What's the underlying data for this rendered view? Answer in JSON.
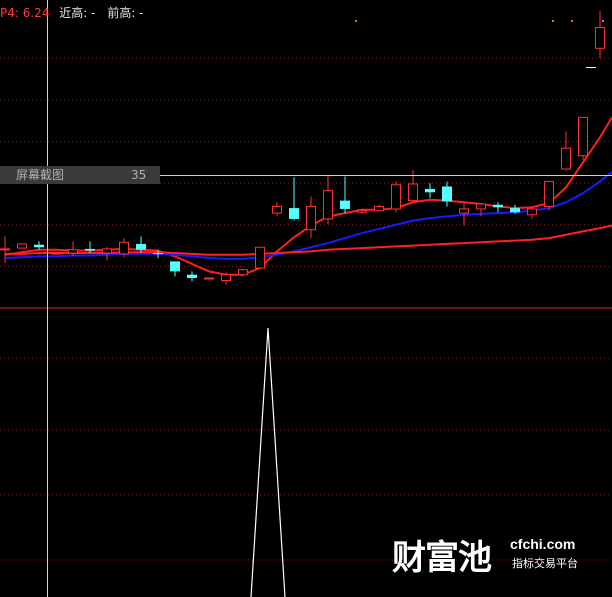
{
  "legend": {
    "p4_label": "P4: 6.24",
    "recent_high_label": "近高: -",
    "prev_high_label": "前高: -"
  },
  "crosshair": {
    "indicator_name": "屏幕截图",
    "value": "35"
  },
  "watermark": {
    "brand": "财富池",
    "site": "cfchi.com",
    "tagline": "指标交易平台"
  },
  "colors": {
    "up_candle": "#ff3232",
    "down_candle": "#54ffff",
    "ma_short": "#ff2020",
    "ma_mid": "#1a1aff",
    "ma_long": "#ff2020",
    "grid": "#7a1f1f",
    "crosshair": "#d0d0d0",
    "separator": "#8b1a1a",
    "indicator_line": "#ffffff"
  },
  "chart_data": [
    {
      "type": "candlestick",
      "candles": [
        {
          "o": 0.7,
          "c": 0.71,
          "h": 0.86,
          "l": 0.54
        },
        {
          "o": 0.72,
          "c": 0.77,
          "h": 0.77,
          "l": 0.72
        },
        {
          "o": 0.76,
          "c": 0.73,
          "h": 0.8,
          "l": 0.7
        },
        {
          "o": 0.66,
          "c": 0.66,
          "h": 0.66,
          "l": 0.66
        },
        {
          "o": 0.66,
          "c": 0.7,
          "h": 0.8,
          "l": 0.62
        },
        {
          "o": 0.71,
          "c": 0.69,
          "h": 0.8,
          "l": 0.66
        },
        {
          "o": 0.66,
          "c": 0.71,
          "h": 0.73,
          "l": 0.57
        },
        {
          "o": 0.65,
          "c": 0.79,
          "h": 0.84,
          "l": 0.61
        },
        {
          "o": 0.77,
          "c": 0.7,
          "h": 0.86,
          "l": 0.66
        },
        {
          "o": 0.66,
          "c": 0.65,
          "h": 0.7,
          "l": 0.6
        },
        {
          "o": 0.56,
          "c": 0.44,
          "h": 0.56,
          "l": 0.38
        },
        {
          "o": 0.4,
          "c": 0.36,
          "h": 0.44,
          "l": 0.32
        },
        {
          "o": 0.36,
          "c": 0.36,
          "h": 0.36,
          "l": 0.36
        },
        {
          "o": 0.33,
          "c": 0.4,
          "h": 0.43,
          "l": 0.28
        },
        {
          "o": 0.4,
          "c": 0.46,
          "h": 0.47,
          "l": 0.38
        },
        {
          "o": 0.48,
          "c": 0.73,
          "h": 0.73,
          "l": 0.48
        },
        {
          "o": 1.14,
          "c": 1.22,
          "h": 1.27,
          "l": 1.1
        },
        {
          "o": 1.2,
          "c": 1.07,
          "h": 1.57,
          "l": 1.05
        },
        {
          "o": 0.94,
          "c": 1.22,
          "h": 1.34,
          "l": 0.84
        },
        {
          "o": 1.07,
          "c": 1.41,
          "h": 1.6,
          "l": 1.01
        },
        {
          "o": 1.29,
          "c": 1.19,
          "h": 1.58,
          "l": 1.14
        },
        {
          "o": 1.15,
          "c": 1.17,
          "h": 1.17,
          "l": 1.13
        },
        {
          "o": 1.17,
          "c": 1.22,
          "h": 1.24,
          "l": 1.17
        },
        {
          "o": 1.19,
          "c": 1.48,
          "h": 1.52,
          "l": 1.15
        },
        {
          "o": 1.29,
          "c": 1.49,
          "h": 1.66,
          "l": 1.27
        },
        {
          "o": 1.43,
          "c": 1.39,
          "h": 1.5,
          "l": 1.32
        },
        {
          "o": 1.46,
          "c": 1.28,
          "h": 1.52,
          "l": 1.22
        },
        {
          "o": 1.14,
          "c": 1.19,
          "h": 1.27,
          "l": 0.99
        },
        {
          "o": 1.19,
          "c": 1.25,
          "h": 1.25,
          "l": 1.1
        },
        {
          "o": 1.24,
          "c": 1.21,
          "h": 1.27,
          "l": 1.15
        },
        {
          "o": 1.2,
          "c": 1.15,
          "h": 1.24,
          "l": 1.13
        },
        {
          "o": 1.12,
          "c": 1.19,
          "h": 1.22,
          "l": 1.07
        },
        {
          "o": 1.22,
          "c": 1.52,
          "h": 1.52,
          "l": 1.17
        },
        {
          "o": 1.67,
          "c": 1.92,
          "h": 2.12,
          "l": 1.65
        },
        {
          "o": 1.83,
          "c": 2.29,
          "h": 2.29,
          "l": 1.78
        },
        {
          "o": 3.12,
          "c": 3.37,
          "h": 3.57,
          "l": 3.0
        }
      ],
      "ma_short": [
        0.64,
        0.67,
        0.7,
        0.7,
        0.69,
        0.69,
        0.7,
        0.71,
        0.7,
        0.69,
        0.62,
        0.53,
        0.44,
        0.4,
        0.4,
        0.48,
        0.68,
        0.85,
        0.99,
        1.1,
        1.14,
        1.18,
        1.18,
        1.2,
        1.27,
        1.3,
        1.29,
        1.27,
        1.25,
        1.22,
        1.2,
        1.21,
        1.26,
        1.45,
        1.75,
        2.05
      ],
      "ma_mid": [
        0.6,
        0.61,
        0.62,
        0.62,
        0.63,
        0.63,
        0.64,
        0.65,
        0.65,
        0.65,
        0.64,
        0.62,
        0.6,
        0.59,
        0.59,
        0.61,
        0.64,
        0.68,
        0.73,
        0.78,
        0.84,
        0.9,
        0.95,
        1.0,
        1.05,
        1.08,
        1.1,
        1.12,
        1.13,
        1.14,
        1.15,
        1.17,
        1.2,
        1.27,
        1.38,
        1.52
      ],
      "ma_long": [
        0.65,
        0.65,
        0.66,
        0.66,
        0.66,
        0.66,
        0.66,
        0.67,
        0.67,
        0.67,
        0.66,
        0.65,
        0.64,
        0.64,
        0.64,
        0.65,
        0.66,
        0.67,
        0.68,
        0.7,
        0.71,
        0.72,
        0.73,
        0.74,
        0.75,
        0.76,
        0.77,
        0.78,
        0.79,
        0.8,
        0.81,
        0.82,
        0.84,
        0.88,
        0.92,
        0.96
      ]
    },
    {
      "type": "line",
      "values": [
        0,
        0,
        0,
        0,
        0,
        0,
        0,
        0,
        0,
        0,
        0,
        0,
        0,
        0,
        0,
        100,
        0,
        0,
        0,
        0,
        0,
        0,
        0,
        0,
        0,
        0,
        0,
        0,
        0,
        0,
        0,
        0,
        0,
        0,
        0,
        0
      ]
    }
  ]
}
